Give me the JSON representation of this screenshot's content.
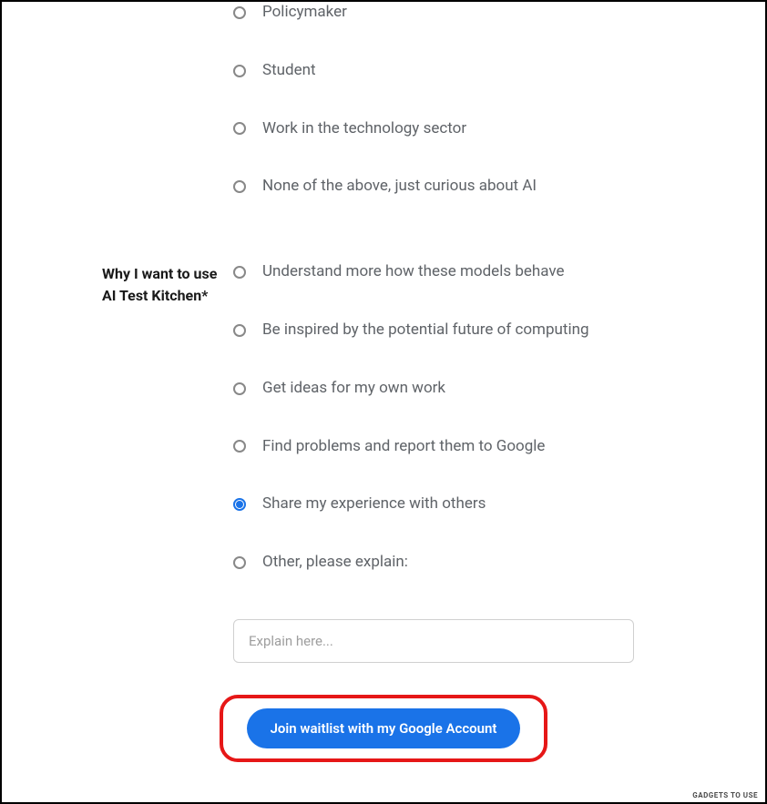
{
  "section1": {
    "options": [
      {
        "label": "Policymaker",
        "selected": false
      },
      {
        "label": "Student",
        "selected": false
      },
      {
        "label": "Work in the technology sector",
        "selected": false
      },
      {
        "label": "None of the above, just curious about AI",
        "selected": false
      }
    ]
  },
  "section2": {
    "title": "Why I want to use AI Test Kitchen*",
    "options": [
      {
        "label": "Understand more how these models behave",
        "selected": false
      },
      {
        "label": "Be inspired by the potential future of computing",
        "selected": false
      },
      {
        "label": "Get ideas for my own work",
        "selected": false
      },
      {
        "label": "Find problems and report them to Google",
        "selected": false
      },
      {
        "label": "Share my experience with others",
        "selected": true
      },
      {
        "label": "Other, please explain:",
        "selected": false
      }
    ],
    "explain_placeholder": "Explain here..."
  },
  "submit_label": "Join waitlist with my Google Account",
  "watermark": "GADGETS TO USE"
}
